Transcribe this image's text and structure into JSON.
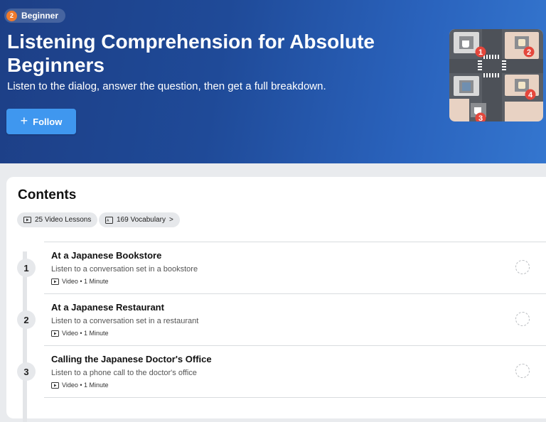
{
  "header": {
    "level_number": "2",
    "level_label": "Beginner",
    "title": "Listening Comprehension for Absolute Beginners",
    "subtitle": "Listen to the dialog, answer the question, then get a full breakdown.",
    "follow_icon": "+",
    "follow_label": "Follow",
    "thumbnail_markers": [
      "1",
      "2",
      "3",
      "4"
    ]
  },
  "contents": {
    "title": "Contents",
    "chips": {
      "videos": "25 Video Lessons",
      "vocab": "169 Vocabulary",
      "vocab_arrow": ">"
    },
    "lessons": [
      {
        "number": "1",
        "title": "At a Japanese Bookstore",
        "description": "Listen to a conversation set in a bookstore",
        "meta": "Video • 1 Minute"
      },
      {
        "number": "2",
        "title": "At a Japanese Restaurant",
        "description": "Listen to a conversation set in a restaurant",
        "meta": "Video • 1 Minute"
      },
      {
        "number": "3",
        "title": "Calling the Japanese Doctor's Office",
        "description": "Listen to a phone call to the doctor's office",
        "meta": "Video • 1 Minute"
      }
    ]
  },
  "colors": {
    "hero_dark": "#1d3f86",
    "hero_light": "#3476cf",
    "follow_button": "#3f97ef",
    "level_badge": "#f07a2b",
    "marker_red": "#e4473c"
  },
  "icons": {
    "follow": "plus-icon",
    "video": "video-play-icon",
    "vocab": "vocabulary-card-icon",
    "progress": "incomplete-circle-icon"
  }
}
